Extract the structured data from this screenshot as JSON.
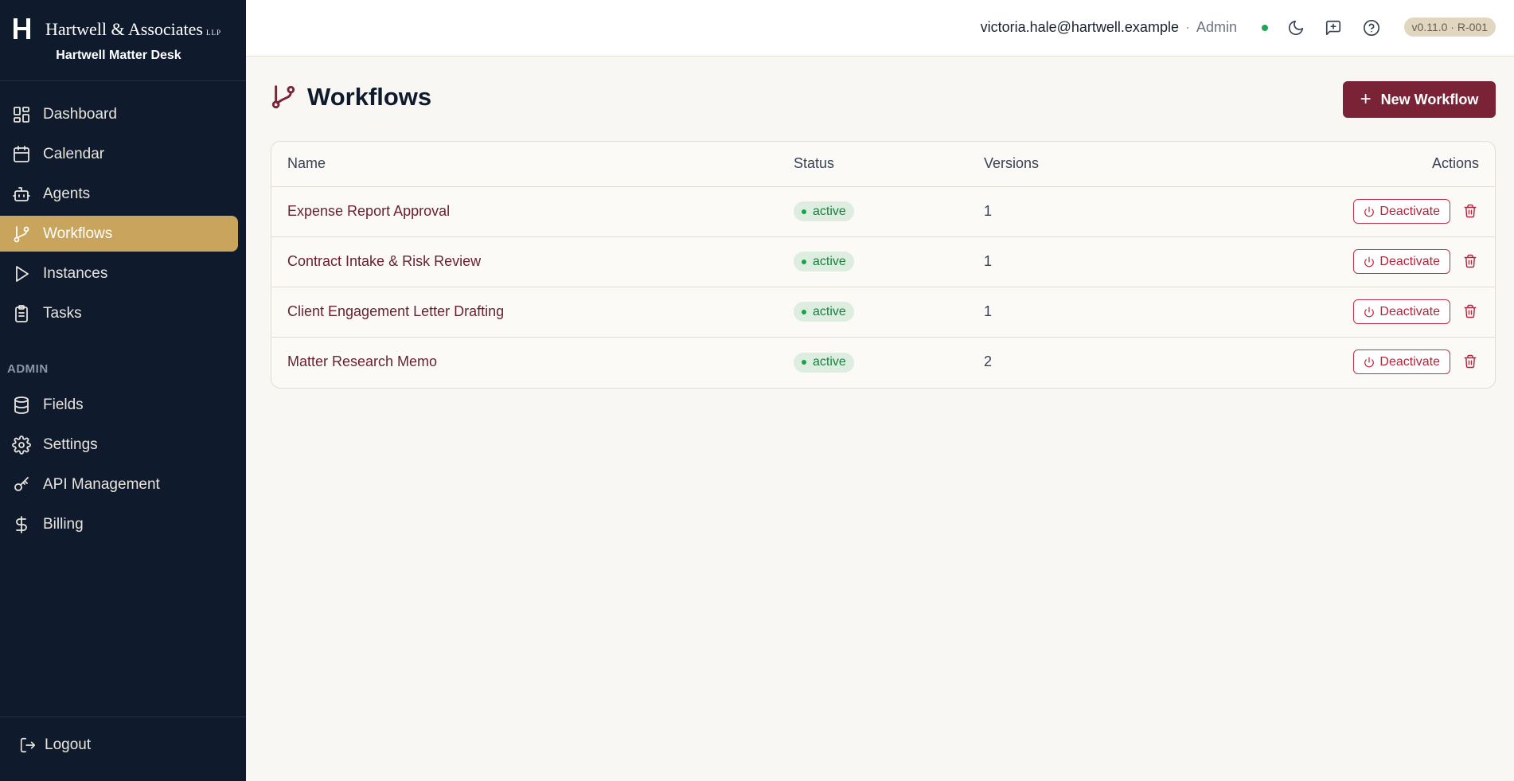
{
  "brand": {
    "logo_letter": "H",
    "name": "Hartwell & Associates",
    "suffix": "LLP",
    "subtitle": "Hartwell Matter Desk"
  },
  "sidebar": {
    "items": [
      {
        "label": "Dashboard",
        "icon": "dashboard-icon"
      },
      {
        "label": "Calendar",
        "icon": "calendar-icon"
      },
      {
        "label": "Agents",
        "icon": "robot-icon"
      },
      {
        "label": "Workflows",
        "icon": "git-branch-icon",
        "active": true
      },
      {
        "label": "Instances",
        "icon": "play-icon"
      },
      {
        "label": "Tasks",
        "icon": "clipboard-icon"
      }
    ],
    "admin_heading": "ADMIN",
    "admin_items": [
      {
        "label": "Fields",
        "icon": "database-icon"
      },
      {
        "label": "Settings",
        "icon": "gear-icon"
      },
      {
        "label": "API Management",
        "icon": "key-icon"
      },
      {
        "label": "Billing",
        "icon": "dollar-icon"
      }
    ],
    "logout_label": "Logout"
  },
  "topbar": {
    "email": "victoria.hale@hartwell.example",
    "separator": "·",
    "role": "Admin",
    "version": "v0.11.0 · R-001"
  },
  "page": {
    "title": "Workflows",
    "new_button_label": "New Workflow"
  },
  "table": {
    "columns": [
      "Name",
      "Status",
      "Versions",
      "Actions"
    ],
    "rows": [
      {
        "name": "Expense Report Approval",
        "status": "active",
        "versions": "1",
        "action": "Deactivate"
      },
      {
        "name": "Contract Intake & Risk Review",
        "status": "active",
        "versions": "1",
        "action": "Deactivate"
      },
      {
        "name": "Client Engagement Letter Drafting",
        "status": "active",
        "versions": "1",
        "action": "Deactivate"
      },
      {
        "name": "Matter Research Memo",
        "status": "active",
        "versions": "2",
        "action": "Deactivate"
      }
    ]
  },
  "colors": {
    "sidebar_bg": "#0f1b2d",
    "accent_gold": "#c9a45c",
    "brand_burgundy": "#7a2236",
    "status_green": "#16a34a",
    "danger_red": "#b4233a"
  }
}
